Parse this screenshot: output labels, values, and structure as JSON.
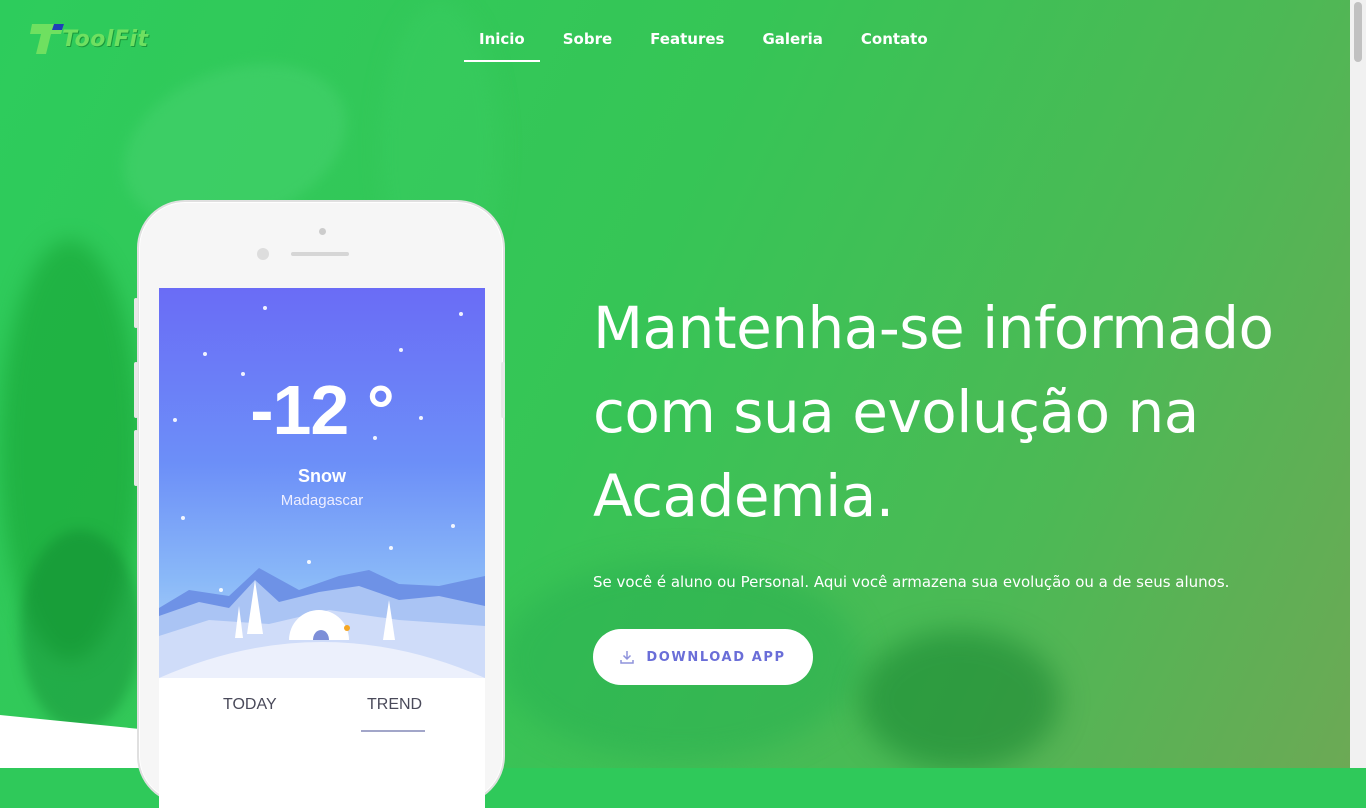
{
  "brand": {
    "name": "ToolFit"
  },
  "nav": {
    "items": [
      {
        "label": "Inicio",
        "active": true
      },
      {
        "label": "Sobre"
      },
      {
        "label": "Features"
      },
      {
        "label": "Galeria"
      },
      {
        "label": "Contato"
      }
    ]
  },
  "hero": {
    "headline": "Mantenha-se informado com sua evolução na Academia.",
    "subtitle": "Se você é aluno ou Personal. Aqui você armazena sua evolução ou a de seus alunos.",
    "cta_label": "DOWNLOAD APP",
    "cta_icon": "download-icon"
  },
  "phone": {
    "temperature": "-12 °",
    "condition": "Snow",
    "location": "Madagascar",
    "tab_today": "TODAY",
    "tab_trend": "TREND"
  },
  "colors": {
    "hero_green": "#2fc95a",
    "accent": "#6a6ed8",
    "weather_gradient_top": "#6a6cf6"
  }
}
